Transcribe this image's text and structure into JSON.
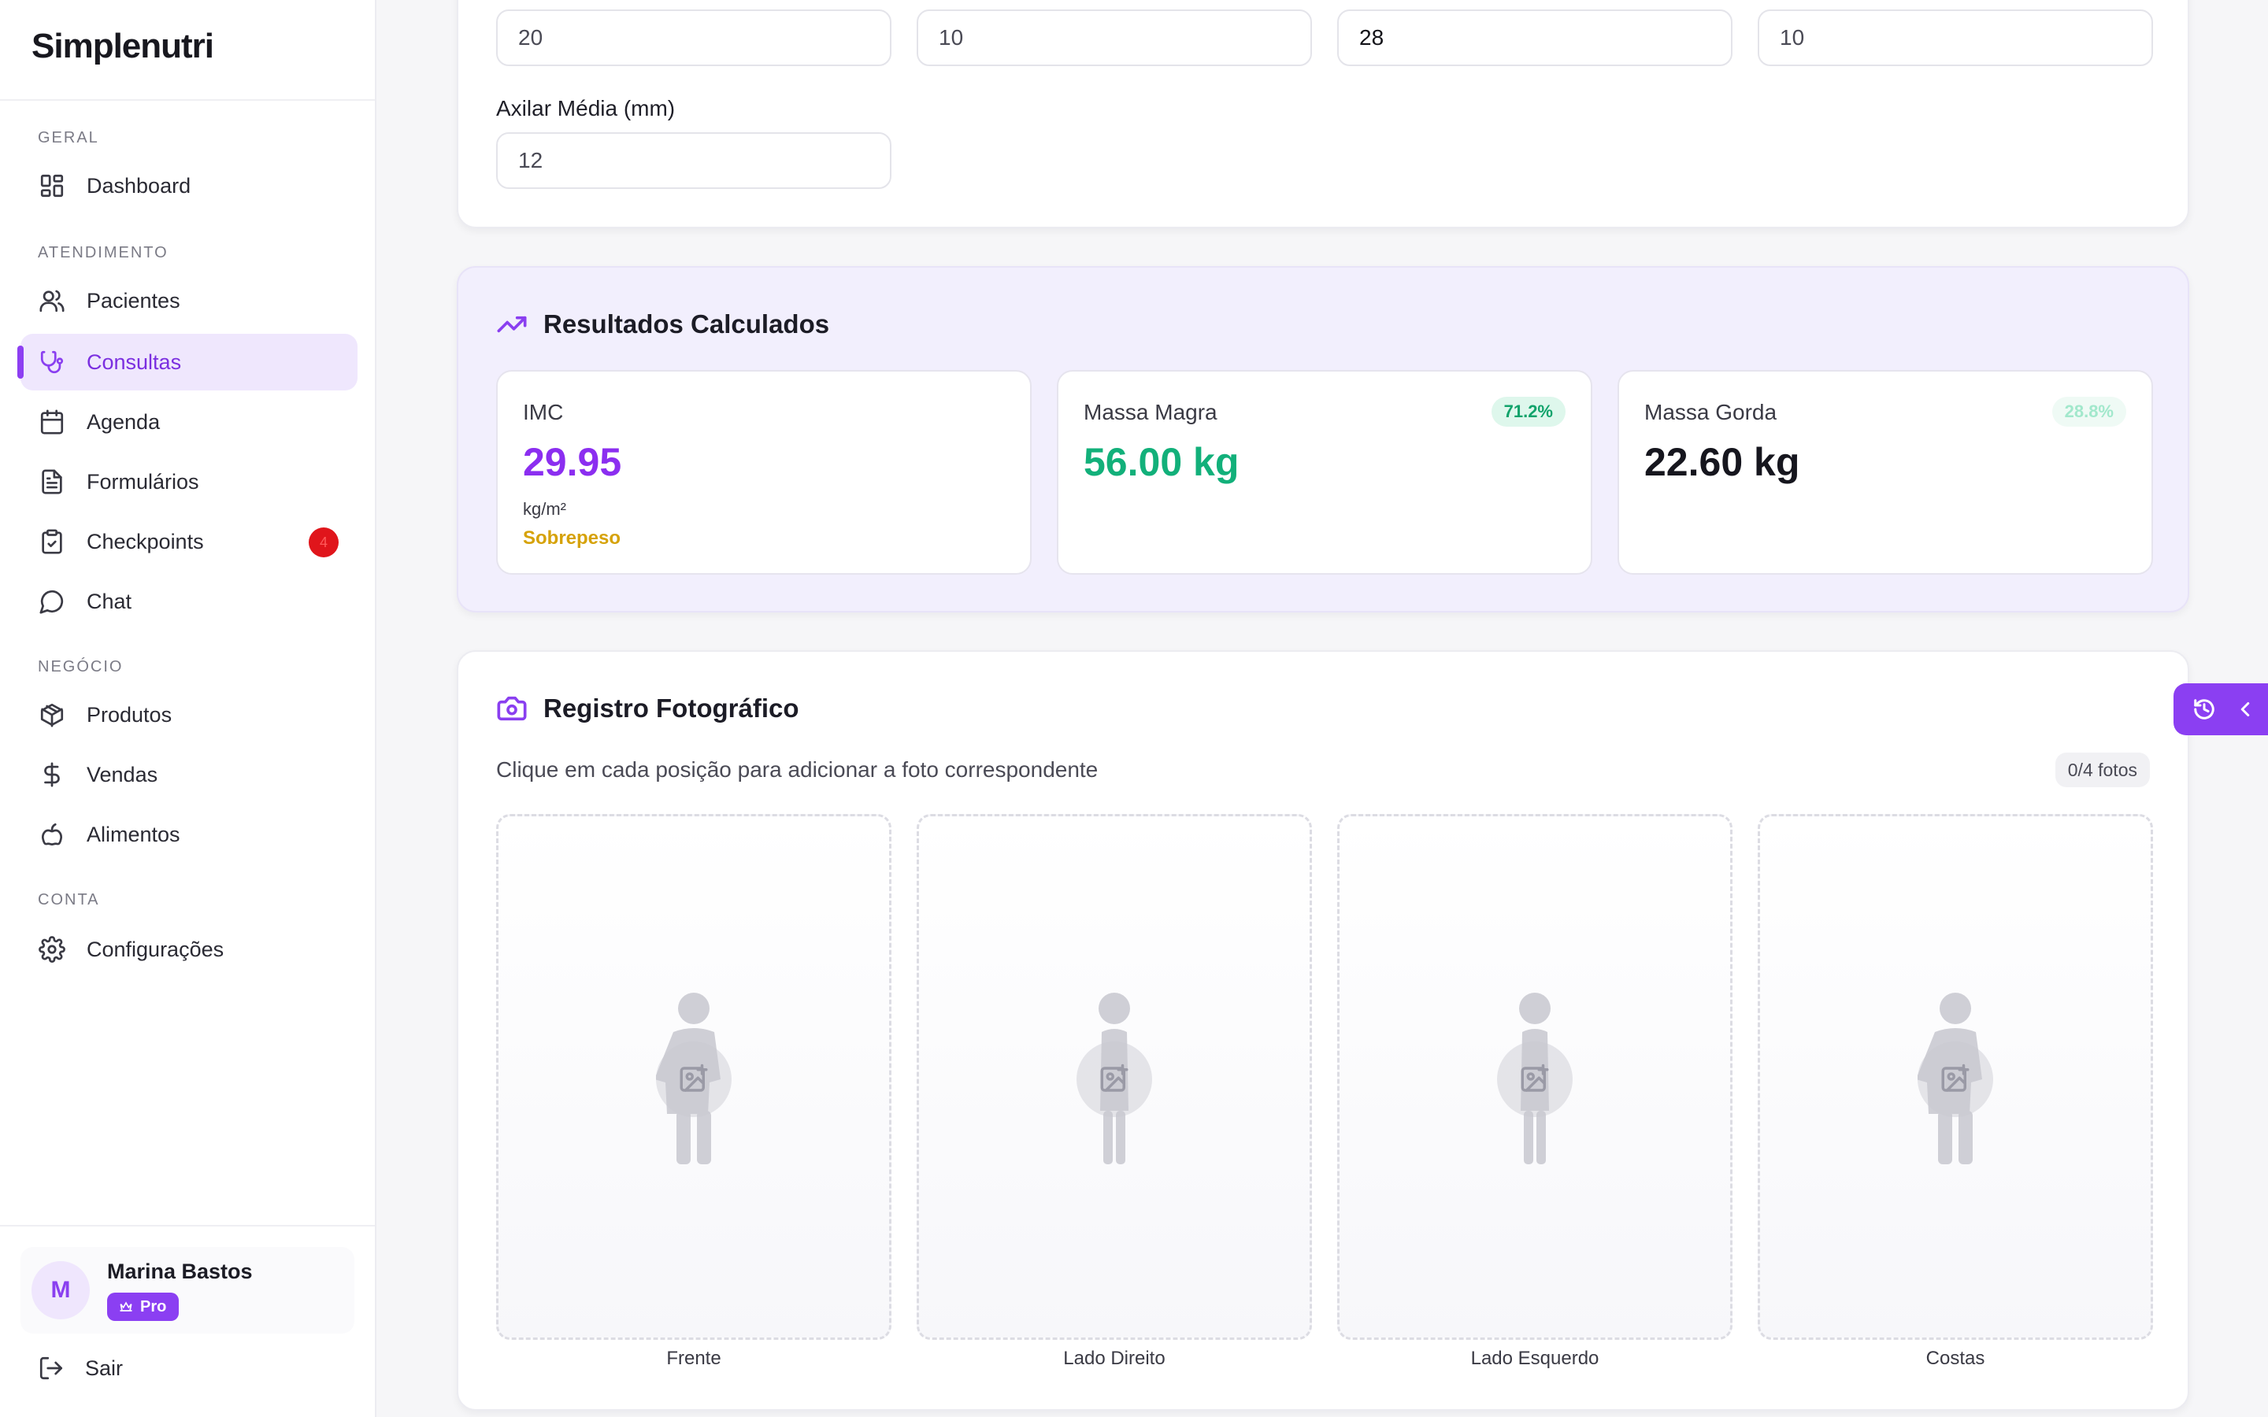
{
  "app": {
    "logo": "Simplenutri"
  },
  "sidebar": {
    "sections": {
      "geral": "GERAL",
      "atendimento": "ATENDIMENTO",
      "negocio": "NEGÓCIO",
      "conta": "CONTA"
    },
    "items": [
      {
        "label": "Dashboard",
        "icon": "dashboard-icon"
      },
      {
        "label": "Pacientes",
        "icon": "users-icon"
      },
      {
        "label": "Consultas",
        "icon": "stethoscope-icon",
        "active": true
      },
      {
        "label": "Agenda",
        "icon": "calendar-icon"
      },
      {
        "label": "Formulários",
        "icon": "file-text-icon"
      },
      {
        "label": "Checkpoints",
        "icon": "clipboard-check-icon",
        "badge": "4"
      },
      {
        "label": "Chat",
        "icon": "chat-icon"
      },
      {
        "label": "Produtos",
        "icon": "package-icon"
      },
      {
        "label": "Vendas",
        "icon": "dollar-icon"
      },
      {
        "label": "Alimentos",
        "icon": "apple-icon"
      },
      {
        "label": "Configurações",
        "icon": "gear-icon"
      }
    ],
    "user": {
      "initial": "M",
      "name": "Marina Bastos",
      "plan": "Pro"
    },
    "logout_label": "Sair"
  },
  "measurements": {
    "top_row_values": [
      "20",
      "10",
      "28",
      "10"
    ],
    "axilar_label": "Axilar Média (mm)",
    "axilar_value": "12"
  },
  "results": {
    "title": "Resultados Calculados",
    "imc": {
      "label": "IMC",
      "value": "29.95",
      "unit": "kg/m²",
      "classification": "Sobrepeso"
    },
    "massa_magra": {
      "label": "Massa Magra",
      "value": "56.00 kg",
      "percent": "71.2%"
    },
    "massa_gorda": {
      "label": "Massa Gorda",
      "value": "22.60 kg",
      "percent": "28.8%"
    }
  },
  "photos": {
    "title": "Registro Fotográfico",
    "subtitle": "Clique em cada posição para adicionar a foto correspondente",
    "count": "0/4 fotos",
    "positions": [
      "Frente",
      "Lado Direito",
      "Lado Esquerdo",
      "Costas"
    ]
  },
  "colors": {
    "accent": "#8b3ff2",
    "green": "#10b77f",
    "warning": "#d6a208",
    "badge_red": "#e0151b"
  }
}
